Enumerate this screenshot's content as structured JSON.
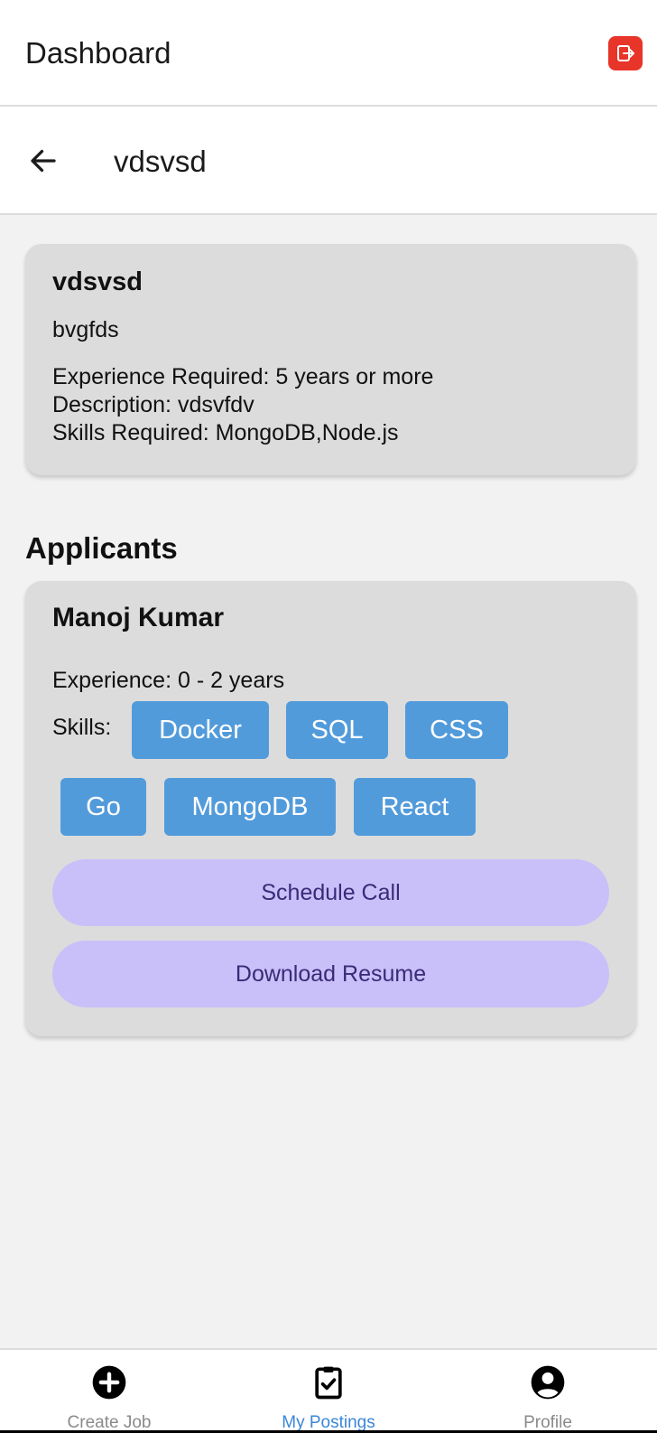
{
  "header": {
    "title": "Dashboard",
    "logout_icon": "logout-icon",
    "logout_color": "#e8352a"
  },
  "subheader": {
    "back_icon": "arrow-left-icon",
    "title": "vdsvsd"
  },
  "job": {
    "title": "vdsvsd",
    "company": "bvgfds",
    "experience": "Experience Required: 5 years or more",
    "description": "Description: vdsvfdv",
    "skills": "Skills Required: MongoDB,Node.js"
  },
  "applicants": {
    "section_title": "Applicants",
    "items": [
      {
        "name": "Manoj Kumar",
        "experience": "Experience: 0 - 2 years",
        "skills_label": "Skills:",
        "skills": [
          "Docker",
          "SQL",
          "CSS",
          "Go",
          "MongoDB",
          "React"
        ],
        "schedule_label": "Schedule Call",
        "download_label": "Download Resume"
      }
    ]
  },
  "bottom_nav": {
    "items": [
      {
        "label": "Create Job",
        "icon": "plus-circle-icon"
      },
      {
        "label": "My Postings",
        "icon": "clipboard-check-icon"
      },
      {
        "label": "Profile",
        "icon": "user-circle-icon"
      }
    ],
    "active_index": 1,
    "active_color": "#3b86d6"
  },
  "colors": {
    "chip": "#529bdb",
    "pill_button": "#c9c0f9",
    "card": "#dcdcdc"
  }
}
